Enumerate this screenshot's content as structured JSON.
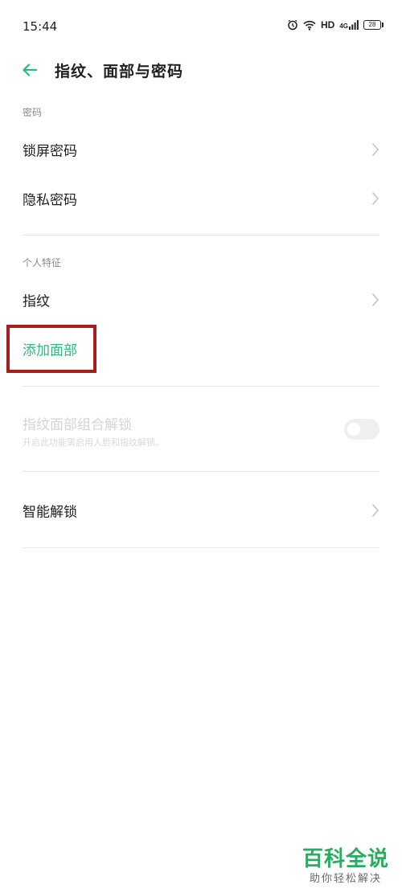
{
  "status_bar": {
    "time": "15:44",
    "network_label": "HD",
    "signal_label": "4G",
    "battery_level": "28",
    "icons": [
      "alarm-icon",
      "wifi-icon",
      "signal-icon",
      "battery-icon"
    ]
  },
  "app_bar": {
    "title": "指纹、面部与密码",
    "back_icon": "back-arrow-icon"
  },
  "sections": {
    "password": {
      "header": "密码",
      "items": [
        {
          "label": "锁屏密码"
        },
        {
          "label": "隐私密码"
        }
      ]
    },
    "personal": {
      "header": "个人特征",
      "items": [
        {
          "label": "指纹"
        },
        {
          "label": "添加面部"
        }
      ]
    },
    "combo_unlock": {
      "title": "指纹面部组合解锁",
      "subtitle": "开启此功能需启用人脸和指纹解锁。",
      "enabled": false
    },
    "smart": {
      "items": [
        {
          "label": "智能解锁"
        }
      ]
    }
  },
  "watermark": {
    "main": "百科全说",
    "sub": "助你轻松解决"
  },
  "colors": {
    "accent": "#2fb87e",
    "highlight": "#a81e1e",
    "watermark": "#2bab62",
    "disabled_text": "#d4d4d4"
  }
}
